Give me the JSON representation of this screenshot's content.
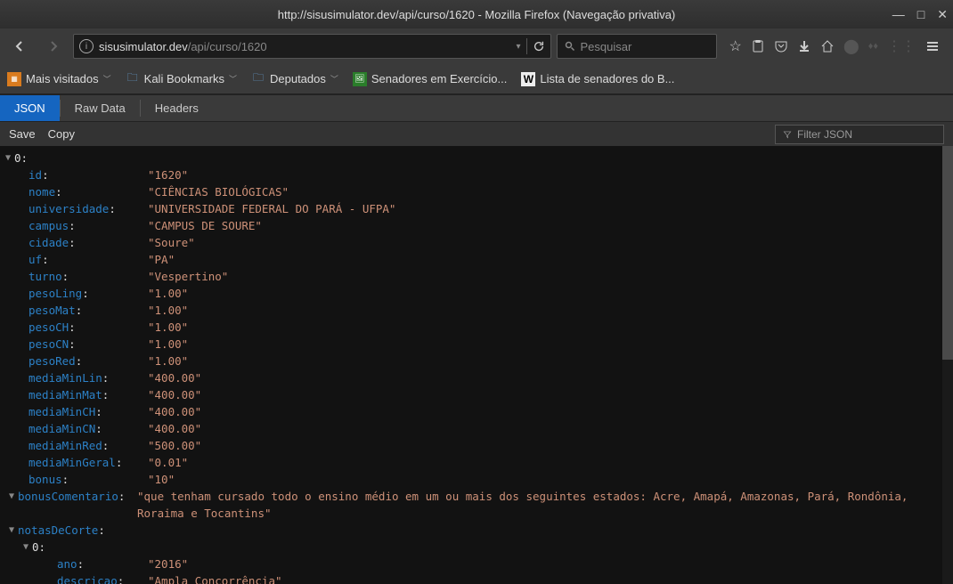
{
  "window": {
    "title": "http://sisusimulator.dev/api/curso/1620 - Mozilla Firefox (Navegação privativa)"
  },
  "nav": {
    "url_host": "sisusimulator.dev",
    "url_path": "/api/curso/1620",
    "search_placeholder": "Pesquisar"
  },
  "bookmarks": {
    "most_visited": "Mais visitados",
    "kali": "Kali Bookmarks",
    "deputados": "Deputados",
    "senadores_ex": "Senadores em Exercício...",
    "lista_senadores": "Lista de senadores do B..."
  },
  "jv": {
    "tab_json": "JSON",
    "tab_raw": "Raw Data",
    "tab_headers": "Headers",
    "save": "Save",
    "copy": "Copy",
    "filter_placeholder": "Filter JSON"
  },
  "json": {
    "index0": "0",
    "rows": [
      {
        "k": "id",
        "v": "\"1620\""
      },
      {
        "k": "nome",
        "v": "\"CIÊNCIAS BIOLÓGICAS\""
      },
      {
        "k": "universidade",
        "v": "\"UNIVERSIDADE FEDERAL DO PARÁ - UFPA\""
      },
      {
        "k": "campus",
        "v": "\"CAMPUS DE SOURE\""
      },
      {
        "k": "cidade",
        "v": "\"Soure\""
      },
      {
        "k": "uf",
        "v": "\"PA\""
      },
      {
        "k": "turno",
        "v": "\"Vespertino\""
      },
      {
        "k": "pesoLing",
        "v": "\"1.00\""
      },
      {
        "k": "pesoMat",
        "v": "\"1.00\""
      },
      {
        "k": "pesoCH",
        "v": "\"1.00\""
      },
      {
        "k": "pesoCN",
        "v": "\"1.00\""
      },
      {
        "k": "pesoRed",
        "v": "\"1.00\""
      },
      {
        "k": "mediaMinLin",
        "v": "\"400.00\""
      },
      {
        "k": "mediaMinMat",
        "v": "\"400.00\""
      },
      {
        "k": "mediaMinCH",
        "v": "\"400.00\""
      },
      {
        "k": "mediaMinCN",
        "v": "\"400.00\""
      },
      {
        "k": "mediaMinRed",
        "v": "\"500.00\""
      },
      {
        "k": "mediaMinGeral",
        "v": "\"0.01\""
      },
      {
        "k": "bonus",
        "v": "\"10\""
      }
    ],
    "bonusComentario_k": "bonusComentario",
    "bonusComentario_v": "\"que tenham cursado todo o ensino médio em um ou mais dos seguintes estados: Acre, Amapá, Amazonas, Pará, Rondônia, Roraima e Tocantins\"",
    "notasDeCorte_k": "notasDeCorte",
    "ndc_index0": "0",
    "ndc_rows": [
      {
        "k": "ano",
        "v": "\"2016\""
      },
      {
        "k": "descricao",
        "v": "\"Ampla Concorrência\""
      }
    ]
  }
}
